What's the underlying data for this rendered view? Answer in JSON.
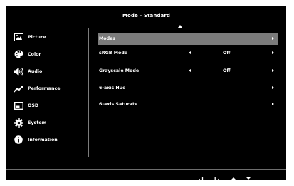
{
  "header": {
    "title": "Mode - Standard"
  },
  "sidebar": {
    "items": [
      {
        "label": "Picture",
        "icon": "picture-icon"
      },
      {
        "label": "Color",
        "icon": "palette-icon"
      },
      {
        "label": "Audio",
        "icon": "speaker-icon"
      },
      {
        "label": "Performance",
        "icon": "trend-up-icon"
      },
      {
        "label": "OSD",
        "icon": "osd-icon"
      },
      {
        "label": "System",
        "icon": "gear-icon"
      },
      {
        "label": "Information",
        "icon": "info-icon"
      }
    ]
  },
  "main": {
    "rows": [
      {
        "label": "Modes",
        "value": "",
        "selected": true
      },
      {
        "label": "sRGB Mode",
        "value": "Off"
      },
      {
        "label": "Grayscale Mode",
        "value": "Off"
      },
      {
        "label": "6-axis Hue",
        "value": ""
      },
      {
        "label": "6-axis Saturate",
        "value": ""
      }
    ]
  },
  "footer": {
    "buttons": [
      "back-icon",
      "enter-icon",
      "up-icon",
      "down-icon"
    ]
  },
  "colors": {
    "background": "#000000",
    "selected_row": "#7b7b7b",
    "text": "#ffffff"
  }
}
